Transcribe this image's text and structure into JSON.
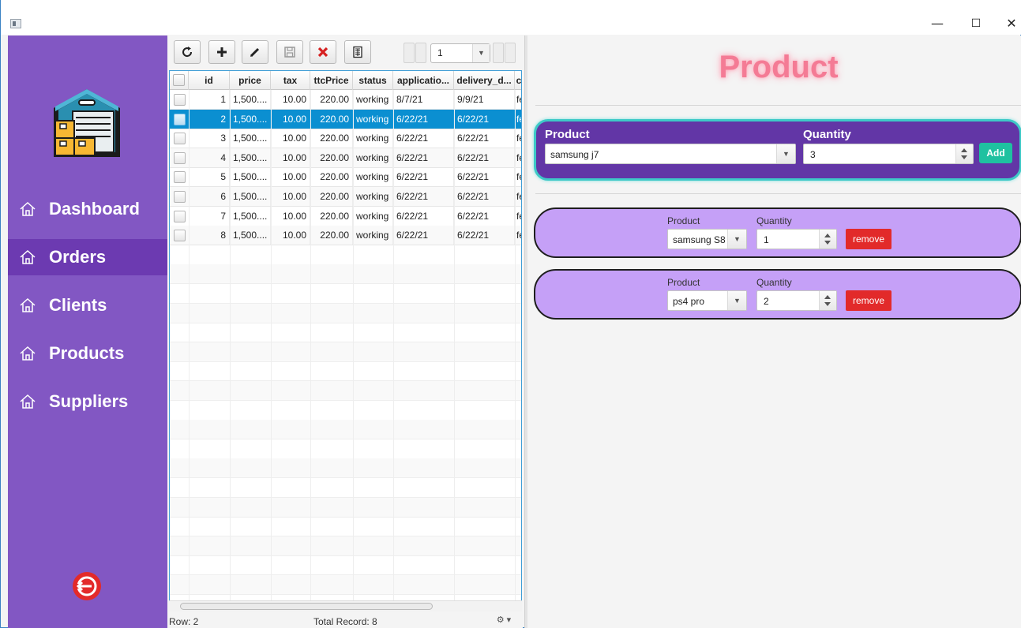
{
  "window": {
    "minimize_glyph": "—",
    "maximize_glyph": "☐",
    "close_glyph": "✕"
  },
  "sidebar": {
    "items": [
      {
        "label": "Dashboard",
        "icon": "home-icon",
        "active": false
      },
      {
        "label": "Orders",
        "icon": "home-icon",
        "active": true
      },
      {
        "label": "Clients",
        "icon": "home-icon",
        "active": false
      },
      {
        "label": "Products",
        "icon": "home-icon",
        "active": false
      },
      {
        "label": "Suppliers",
        "icon": "home-icon",
        "active": false
      }
    ],
    "logo_icon": "warehouse-icon",
    "logout_icon": "logout-icon"
  },
  "toolbar": {
    "buttons": [
      "refresh-icon",
      "add-icon",
      "edit-icon",
      "save-icon",
      "delete-icon",
      "export-icon"
    ],
    "page_value": "1"
  },
  "table": {
    "columns": [
      "id",
      "price",
      "tax",
      "ttcPrice",
      "status",
      "applicatio...",
      "delivery_d...",
      "c"
    ],
    "rows": [
      {
        "id": "1",
        "price": "1,500....",
        "tax": "10.00",
        "ttc": "220.00",
        "status": "working",
        "app": "8/7/21",
        "del": "9/9/21",
        "c": "fe",
        "selected": false
      },
      {
        "id": "2",
        "price": "1,500....",
        "tax": "10.00",
        "ttc": "220.00",
        "status": "working",
        "app": "6/22/21",
        "del": "6/22/21",
        "c": "fe",
        "selected": true
      },
      {
        "id": "3",
        "price": "1,500....",
        "tax": "10.00",
        "ttc": "220.00",
        "status": "working",
        "app": "6/22/21",
        "del": "6/22/21",
        "c": "fe",
        "selected": false
      },
      {
        "id": "4",
        "price": "1,500....",
        "tax": "10.00",
        "ttc": "220.00",
        "status": "working",
        "app": "6/22/21",
        "del": "6/22/21",
        "c": "fe",
        "selected": false
      },
      {
        "id": "5",
        "price": "1,500....",
        "tax": "10.00",
        "ttc": "220.00",
        "status": "working",
        "app": "6/22/21",
        "del": "6/22/21",
        "c": "fe",
        "selected": false
      },
      {
        "id": "6",
        "price": "1,500....",
        "tax": "10.00",
        "ttc": "220.00",
        "status": "working",
        "app": "6/22/21",
        "del": "6/22/21",
        "c": "fe",
        "selected": false
      },
      {
        "id": "7",
        "price": "1,500....",
        "tax": "10.00",
        "ttc": "220.00",
        "status": "working",
        "app": "6/22/21",
        "del": "6/22/21",
        "c": "fe",
        "selected": false
      },
      {
        "id": "8",
        "price": "1,500....",
        "tax": "10.00",
        "ttc": "220.00",
        "status": "working",
        "app": "6/22/21",
        "del": "6/22/21",
        "c": "fe",
        "selected": false
      }
    ],
    "status_row": "Row: 2",
    "total_records": "Total Record: 8",
    "settings_glyph": "⚙ ▾"
  },
  "product_panel": {
    "title": "Product",
    "add_form": {
      "product_label": "Product",
      "quantity_label": "Quantity",
      "product_value": "samsung j7",
      "quantity_value": "3",
      "add_label": "Add"
    },
    "lines": [
      {
        "product_label": "Product",
        "quantity_label": "Quantity",
        "product_value": "samsung S8",
        "quantity_value": "1",
        "remove_label": "remove"
      },
      {
        "product_label": "Product",
        "quantity_label": "Quantity",
        "product_value": "ps4 pro",
        "quantity_value": "2",
        "remove_label": "remove"
      }
    ]
  },
  "colors": {
    "sidebar": "#8257c3",
    "sidebar_active": "#6c3ab1",
    "selection": "#0b8fd1",
    "title_pink": "#f47b95",
    "add_card": "#6236a6",
    "add_card_border": "#3ec9c7",
    "line_card": "#c5a0f7",
    "add_button": "#1fc1a0",
    "remove_button": "#e22a2a"
  }
}
